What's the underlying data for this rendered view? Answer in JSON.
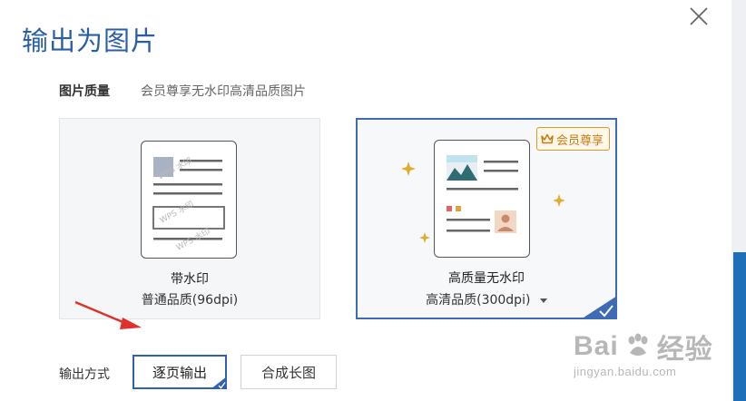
{
  "dialog": {
    "title": "输出为图片",
    "close_icon": "close-icon"
  },
  "quality": {
    "label": "图片质量",
    "description": "会员尊享无水印高清品质图片",
    "options": [
      {
        "title": "带水印",
        "subtitle": "普通品质(96dpi)",
        "selected": false
      },
      {
        "title": "高质量无水印",
        "subtitle": "高清品质(300dpi)",
        "selected": true,
        "badge": "会员尊享",
        "dropdown_icon": "caret-down-icon"
      }
    ]
  },
  "output_mode": {
    "label": "输出方式",
    "buttons": [
      {
        "label": "逐页输出",
        "selected": true
      },
      {
        "label": "合成长图",
        "selected": false
      }
    ]
  },
  "watermark": {
    "brand": "Bai",
    "brand_tail": "经验",
    "url": "jingyan.baidu.com"
  },
  "colors": {
    "accent": "#2f61b0",
    "title": "#2a5fa8",
    "vip": "#d99b2b",
    "scroll": "#1f6fb8",
    "annotation_arrow": "#e0302a"
  }
}
